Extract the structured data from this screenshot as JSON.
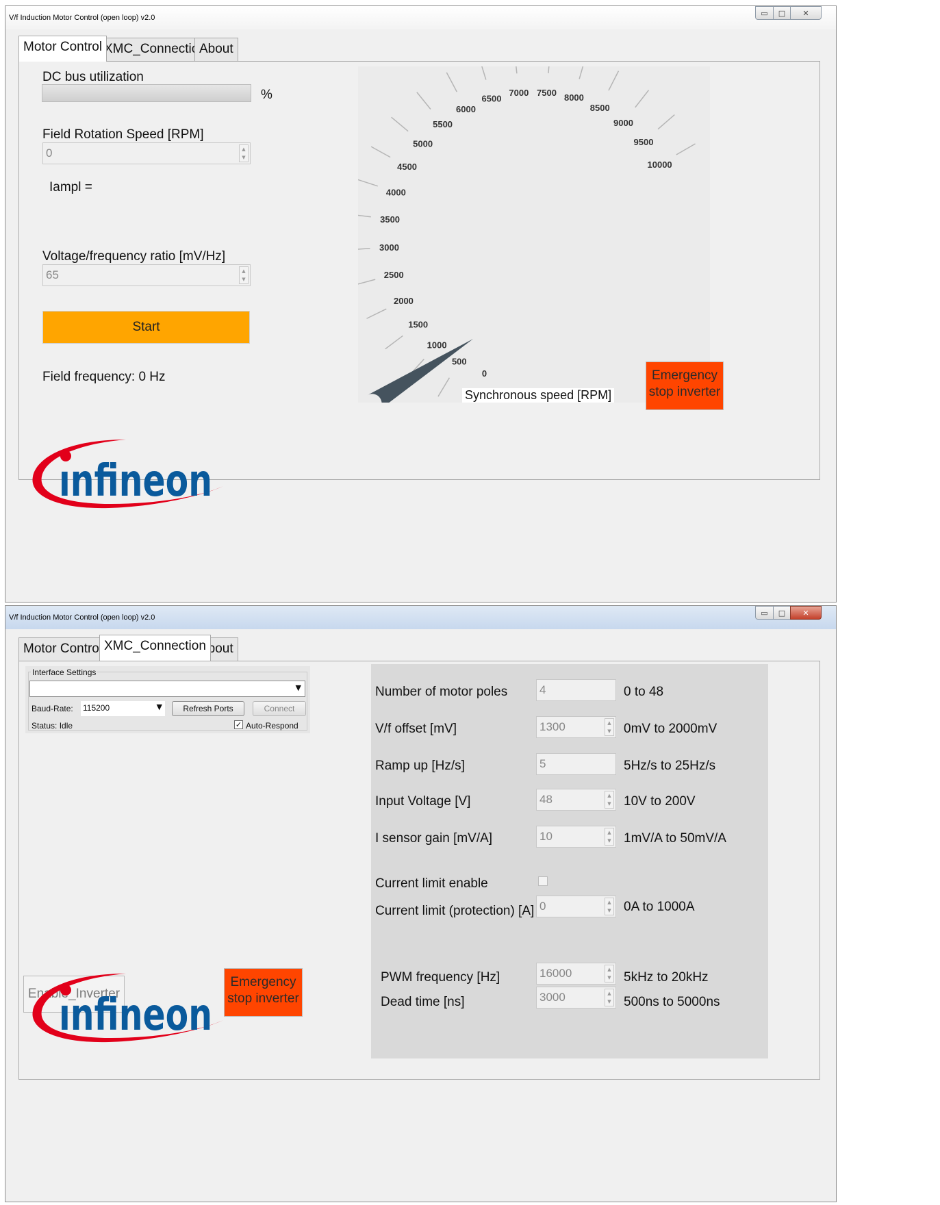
{
  "window1": {
    "title": "V/f Induction Motor Control (open loop) v2.0",
    "tabs": [
      {
        "label": "Motor Control",
        "active": true
      },
      {
        "label": "XMC_Connection",
        "active": false
      },
      {
        "label": "About",
        "active": false
      }
    ],
    "dc_bus": {
      "label": "DC bus utilization",
      "unit": "%",
      "progress_percent": 0
    },
    "field_rotation": {
      "label": "Field Rotation Speed [RPM]",
      "value": "0"
    },
    "iampl": {
      "label": "Iampl ="
    },
    "vf_ratio": {
      "label": "Voltage/frequency ratio [mV/Hz]",
      "value": "65"
    },
    "start_label": "Start",
    "field_frequency": "Field frequency: 0 Hz",
    "emergency": {
      "line1": "Emergency",
      "line2": "stop inverter"
    },
    "gauge": {
      "title": "Synchronous speed [RPM]",
      "ticks": [
        "0",
        "500",
        "1000",
        "1500",
        "2000",
        "2500",
        "3000",
        "3500",
        "4000",
        "4500",
        "5000",
        "5500",
        "6000",
        "6500",
        "7000",
        "7500",
        "8000",
        "8500",
        "9000",
        "9500",
        "10000"
      ],
      "needle_value": 1700,
      "max": 10000
    },
    "logo_text": "infineon"
  },
  "window2": {
    "title": "V/f Induction Motor Control (open loop) v2.0",
    "tabs": [
      {
        "label": "Motor Control",
        "active": false
      },
      {
        "label": "XMC_Connection",
        "active": true
      },
      {
        "label": "About",
        "active": false
      }
    ],
    "interface": {
      "group_title": "Interface Settings",
      "port_value": "",
      "baud_label": "Baud-Rate:",
      "baud_value": "115200",
      "refresh_label": "Refresh Ports",
      "connect_label": "Connect",
      "status": "Status: Idle",
      "auto_respond": "Auto-Respond"
    },
    "params": [
      {
        "label": "Number of motor poles",
        "value": "4",
        "range": "0 to 48",
        "spin": false
      },
      {
        "label": "V/f offset [mV]",
        "value": "1300",
        "range": "0mV to 2000mV",
        "spin": true
      },
      {
        "label": "Ramp up [Hz/s]",
        "value": "5",
        "range": "5Hz/s to 25Hz/s",
        "spin": false
      },
      {
        "label": "Input Voltage [V]",
        "value": "48",
        "range": "10V to 200V",
        "spin": true
      },
      {
        "label": "I sensor gain [mV/A]",
        "value": "10",
        "range": "1mV/A to 50mV/A",
        "spin": true
      }
    ],
    "current_limit_enable": "Current limit enable",
    "current_limit": {
      "label": "Current limit (protection) [A]",
      "value": "0",
      "range": "0A to 1000A"
    },
    "pwm": {
      "label": "PWM frequency [Hz]",
      "value": "16000",
      "range": "5kHz to 20kHz"
    },
    "deadtime": {
      "label": "Dead time [ns]",
      "value": "3000",
      "range": "500ns to 5000ns"
    },
    "enable_inverter": "Enable_Inverter",
    "emergency": {
      "line1": "Emergency",
      "line2": "stop inverter"
    },
    "logo_text": "infineon"
  },
  "colors": {
    "orange": "#ffa500",
    "emergency_red": "#ff4500",
    "gauge_needle": "#45535e",
    "logo_blue": "#0a5a9c",
    "logo_red": "#e2001a"
  }
}
